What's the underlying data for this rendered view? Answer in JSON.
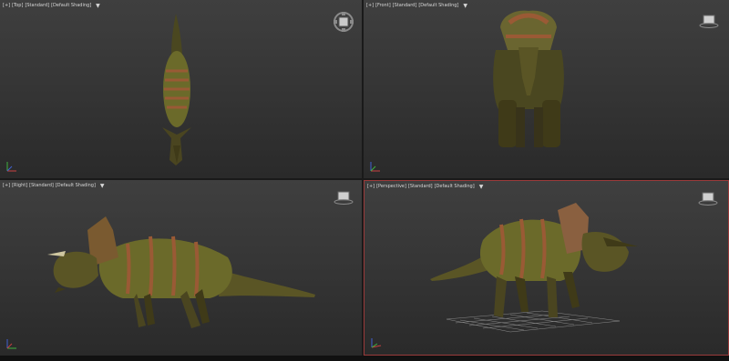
{
  "viewports": {
    "top": {
      "plus": "[+]",
      "view": "[Top]",
      "preset": "[Standard]",
      "shading": "[Default Shading]",
      "filter": "▼"
    },
    "front": {
      "plus": "[+]",
      "view": "[Front]",
      "preset": "[Standard]",
      "shading": "[Default Shading]",
      "filter": "▼"
    },
    "left": {
      "plus": "[+]",
      "view": "[Right]",
      "preset": "[Standard]",
      "shading": "[Default Shading]",
      "filter": "▼"
    },
    "perspective": {
      "plus": "[+]",
      "view": "[Perspective]",
      "preset": "[Standard]",
      "shading": "[Default Shading]",
      "filter": "▼"
    }
  },
  "colors": {
    "viewport_bg": "#3a3a3a",
    "active_border": "#9a3a3a",
    "skin_dark": "#3f3a18",
    "skin_olive": "#6b6a2a",
    "skin_stripe": "#9a5a35"
  },
  "icons": {
    "viewcube": "viewcube-icon",
    "viewcube_small": "viewcube-small-icon",
    "axis": "axis-tripod-icon"
  }
}
